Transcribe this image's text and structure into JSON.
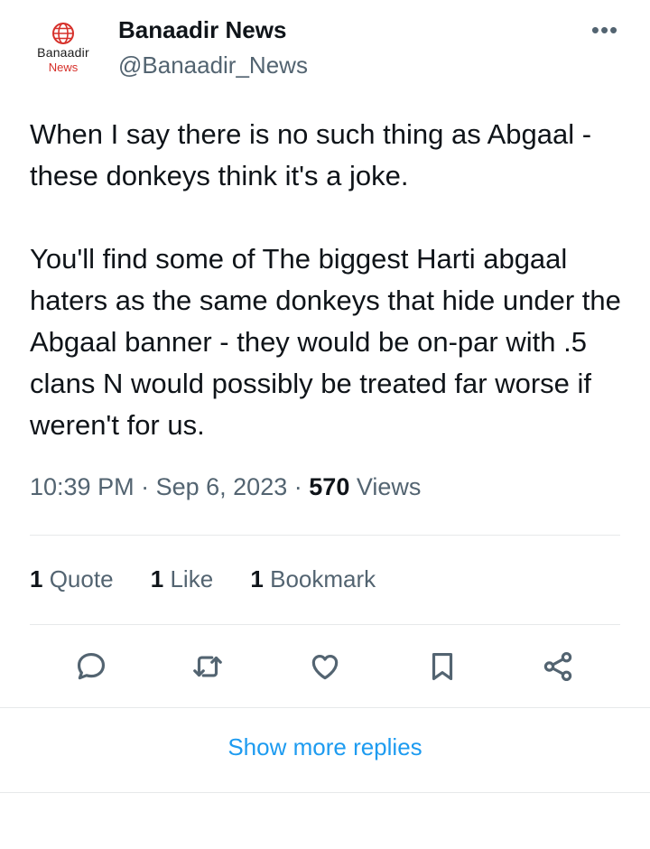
{
  "author": {
    "display_name": "Banaadir News",
    "handle": "@Banaadir_News",
    "avatar": {
      "line1": "Banaadir",
      "line2": "News",
      "icon": "globe-icon",
      "accent_color": "#d6302a"
    },
    "more_icon": "•••"
  },
  "tweet": {
    "paragraph1": "When I say there is no such thing as Abgaal - these donkeys think it's a joke.",
    "paragraph2": "You'll find some of The biggest Harti abgaal haters as the same donkeys that hide under the Abgaal banner - they would be on-par with .5 clans N would possibly be treated far worse if weren't for us."
  },
  "meta": {
    "time": "10:39 PM",
    "separator": "·",
    "date": "Sep 6, 2023",
    "views_count": "570",
    "views_label": "Views"
  },
  "stats": {
    "quotes_count": "1",
    "quotes_label": "Quote",
    "likes_count": "1",
    "likes_label": "Like",
    "bookmarks_count": "1",
    "bookmarks_label": "Bookmark"
  },
  "actions": {
    "reply_icon": "reply-icon",
    "retweet_icon": "retweet-icon",
    "like_icon": "heart-icon",
    "bookmark_icon": "bookmark-icon",
    "share_icon": "share-icon"
  },
  "show_more_replies": "Show more replies",
  "colors": {
    "text": "#0f1419",
    "secondary": "#536471",
    "link": "#1d9bf0",
    "divider": "#e7e9ea"
  }
}
